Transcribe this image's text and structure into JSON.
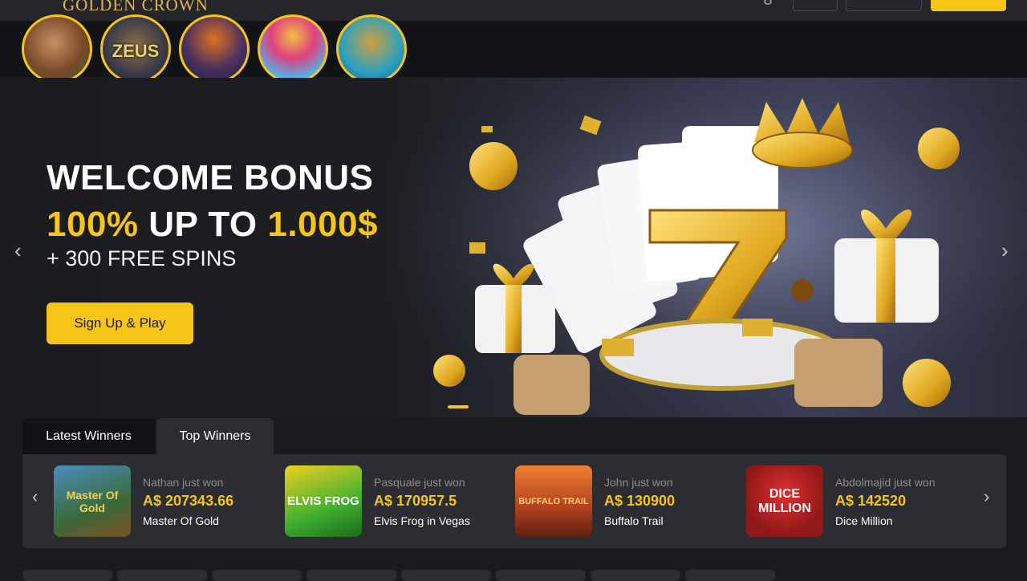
{
  "header": {
    "logo": "GOLDEN CROWN"
  },
  "categories": [
    {
      "icon": "portrait-game-icon",
      "label": ""
    },
    {
      "icon": "zeus-game-icon",
      "label": "ZEUS"
    },
    {
      "icon": "pumpkin-game-icon",
      "label": ""
    },
    {
      "icon": "crown-game-icon",
      "label": ""
    },
    {
      "icon": "dice-game-icon",
      "label": ""
    }
  ],
  "hero": {
    "title_line1": "WELCOME BONUS",
    "title_line2_a": "100%",
    "title_line2_b": " UP TO ",
    "title_line2_c": "1.000$",
    "subtitle": "+ 300 FREE SPINS",
    "cta": "Sign Up & Play",
    "prev": "‹",
    "next": "›"
  },
  "winners": {
    "tabs": [
      "Latest Winners",
      "Top Winners"
    ],
    "prev": "‹",
    "next": "›",
    "items": [
      {
        "name": "Nathan just won",
        "amount": "A$ 207343.66",
        "game": "Master Of Gold",
        "thumb": "Master Of Gold"
      },
      {
        "name": "Pasquale just won",
        "amount": "A$ 170957.5",
        "game": "Elvis Frog in Vegas",
        "thumb": "ELVIS FROG"
      },
      {
        "name": "John just won",
        "amount": "A$ 130900",
        "game": "Buffalo Trail",
        "thumb": "BUFFALO TRAIL"
      },
      {
        "name": "Abdolmajid just won",
        "amount": "A$ 142520",
        "game": "Dice Million",
        "thumb": "DICE MILLION"
      }
    ]
  },
  "colors": {
    "accent": "#f5c518",
    "background": "#1a1b1f",
    "panel": "#2c2d33"
  }
}
